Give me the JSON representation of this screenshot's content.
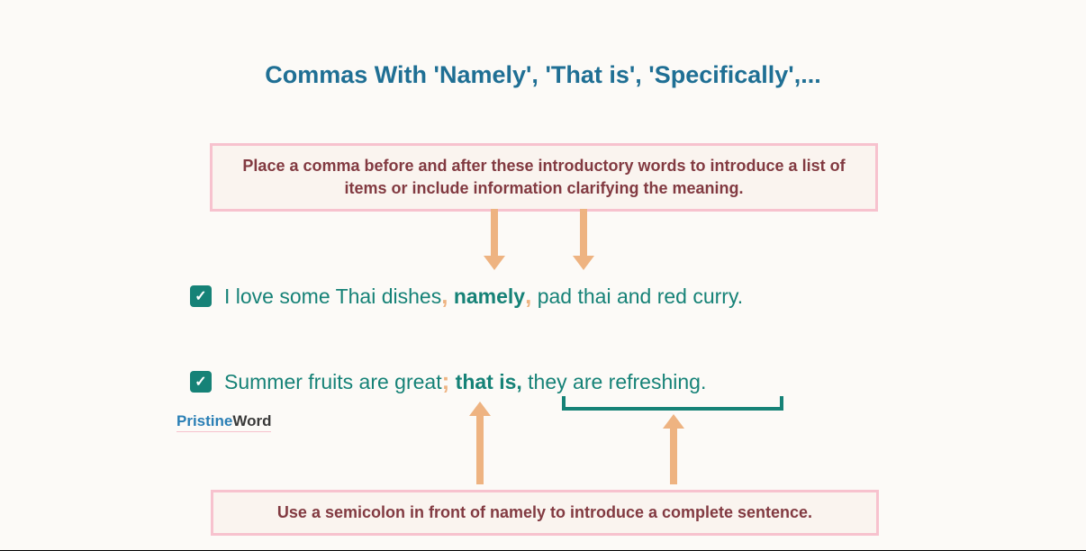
{
  "title": "Commas With 'Namely', 'That is', 'Specifically',...",
  "rule_top": "Place a comma before and after these introductory words to introduce a list of items or include information clarifying the meaning.",
  "rule_bottom": "Use a semicolon in front of namely to introduce a complete sentence.",
  "ex1": {
    "pre": "I love some Thai dishes",
    "p1": ",",
    "word": " namely",
    "p2": ",",
    "post": " pad thai and red curry."
  },
  "ex2": {
    "pre": "Summer fruits are great",
    "p1": ";",
    "word": " that is,",
    "post": " they are refreshing."
  },
  "logo": {
    "a": "Pristine",
    "b": "Word"
  },
  "check": "✓"
}
